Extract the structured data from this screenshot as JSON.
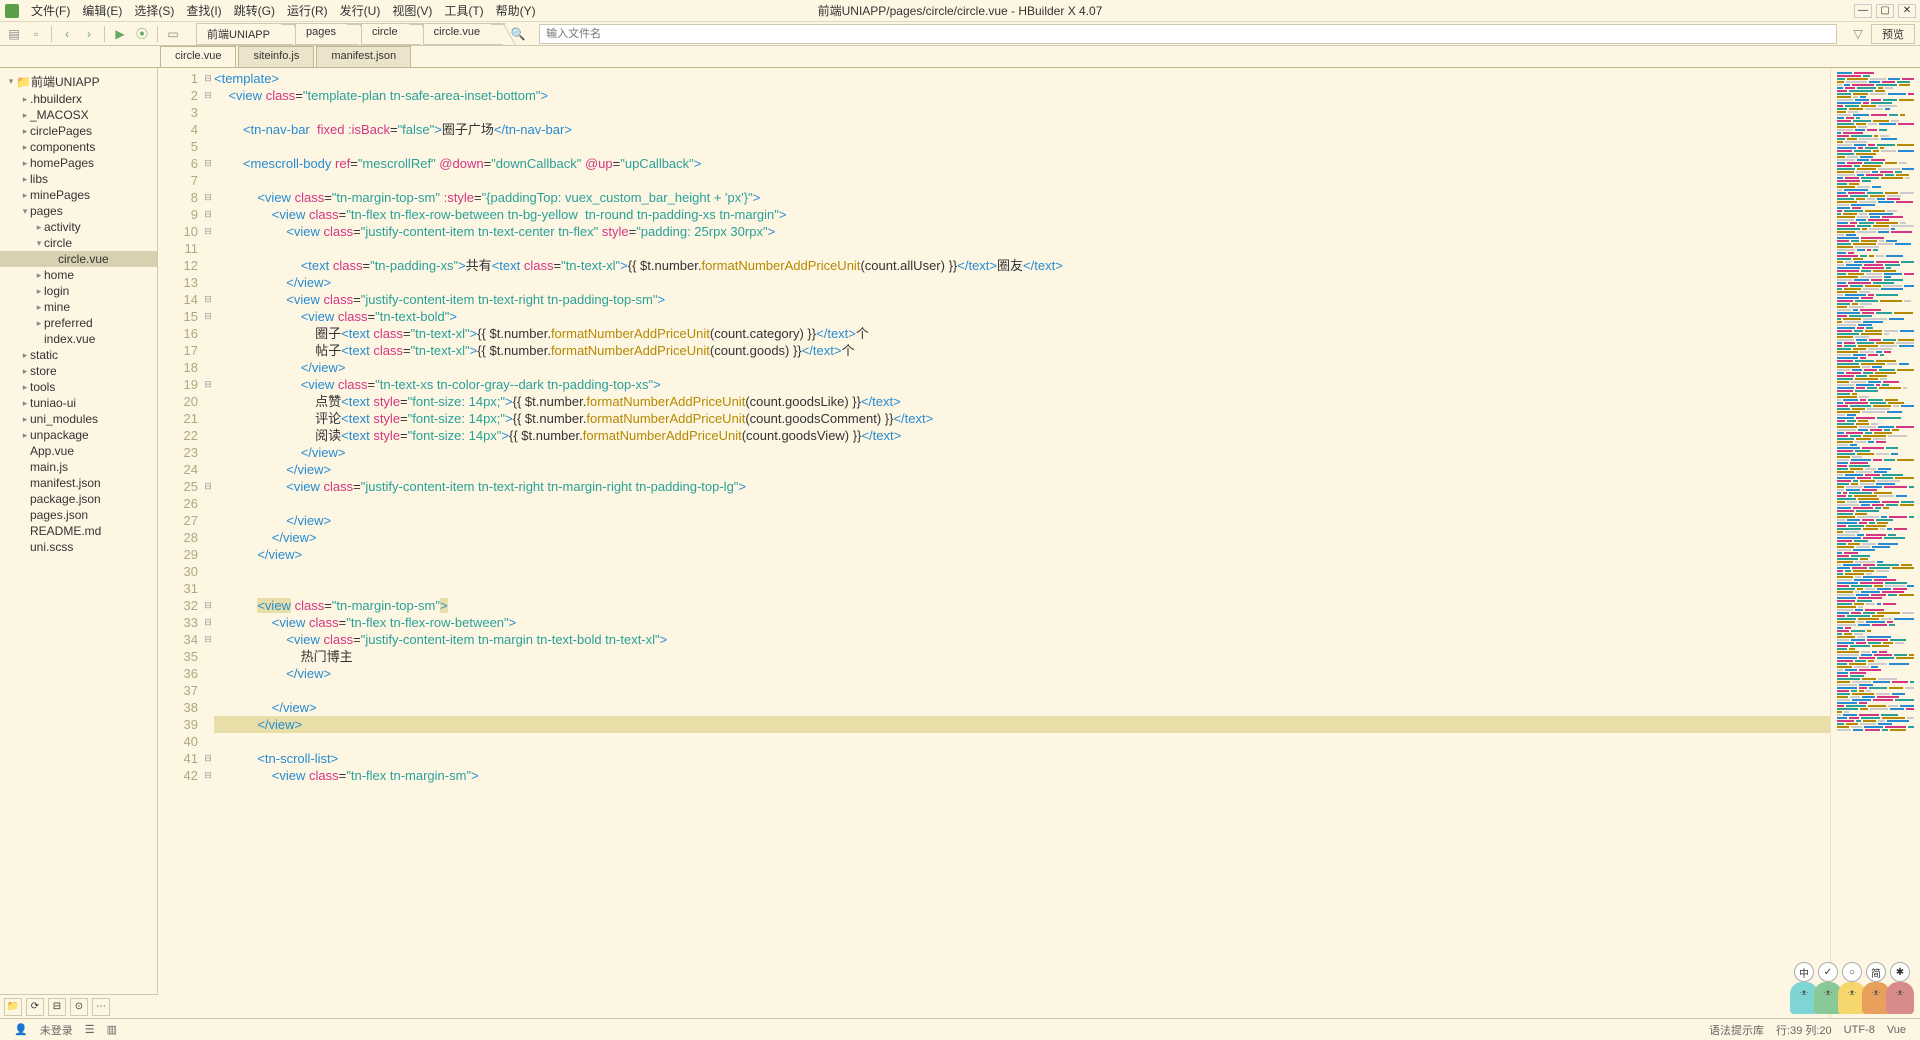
{
  "menu": {
    "items": [
      "文件(F)",
      "编辑(E)",
      "选择(S)",
      "查找(I)",
      "跳转(G)",
      "运行(R)",
      "发行(U)",
      "视图(V)",
      "工具(T)",
      "帮助(Y)"
    ],
    "title": "前端UNIAPP/pages/circle/circle.vue - HBuilder X 4.07"
  },
  "toolbar": {
    "crumbs": [
      "前端UNIAPP",
      "pages",
      "circle",
      "circle.vue"
    ],
    "search_ph": "输入文件名",
    "preview": "预览"
  },
  "tabs": [
    "circle.vue",
    "siteinfo.js",
    "manifest.json"
  ],
  "tree": [
    {
      "d": 0,
      "a": "▾",
      "t": "前端UNIAPP",
      "icon": "📁"
    },
    {
      "d": 1,
      "a": "▸",
      "t": ".hbuilderx"
    },
    {
      "d": 1,
      "a": "▸",
      "t": "_MACOSX"
    },
    {
      "d": 1,
      "a": "▸",
      "t": "circlePages"
    },
    {
      "d": 1,
      "a": "▸",
      "t": "components"
    },
    {
      "d": 1,
      "a": "▸",
      "t": "homePages"
    },
    {
      "d": 1,
      "a": "▸",
      "t": "libs"
    },
    {
      "d": 1,
      "a": "▸",
      "t": "minePages"
    },
    {
      "d": 1,
      "a": "▾",
      "t": "pages"
    },
    {
      "d": 2,
      "a": "▸",
      "t": "activity"
    },
    {
      "d": 2,
      "a": "▾",
      "t": "circle"
    },
    {
      "d": 3,
      "a": "",
      "t": "circle.vue",
      "sel": true
    },
    {
      "d": 2,
      "a": "▸",
      "t": "home"
    },
    {
      "d": 2,
      "a": "▸",
      "t": "login"
    },
    {
      "d": 2,
      "a": "▸",
      "t": "mine"
    },
    {
      "d": 2,
      "a": "▸",
      "t": "preferred"
    },
    {
      "d": 2,
      "a": "",
      "t": "index.vue"
    },
    {
      "d": 1,
      "a": "▸",
      "t": "static"
    },
    {
      "d": 1,
      "a": "▸",
      "t": "store"
    },
    {
      "d": 1,
      "a": "▸",
      "t": "tools"
    },
    {
      "d": 1,
      "a": "▸",
      "t": "tuniao-ui"
    },
    {
      "d": 1,
      "a": "▸",
      "t": "uni_modules"
    },
    {
      "d": 1,
      "a": "▸",
      "t": "unpackage"
    },
    {
      "d": 1,
      "a": "",
      "t": "App.vue"
    },
    {
      "d": 1,
      "a": "",
      "t": "main.js"
    },
    {
      "d": 1,
      "a": "",
      "t": "manifest.json"
    },
    {
      "d": 1,
      "a": "",
      "t": "package.json"
    },
    {
      "d": 1,
      "a": "",
      "t": "pages.json"
    },
    {
      "d": 1,
      "a": "",
      "t": "README.md"
    },
    {
      "d": 1,
      "a": "",
      "t": "uni.scss"
    }
  ],
  "status": {
    "login": "未登录",
    "lang": "语法提示库",
    "pos": "行:39 列:20",
    "enc": "UTF-8",
    "type": "Vue"
  },
  "cats": [
    {
      "c": "#7fd4d4",
      "b": "中"
    },
    {
      "c": "#89c997",
      "b": "✓"
    },
    {
      "c": "#f5d76e",
      "b": "○"
    },
    {
      "c": "#e8a05c",
      "b": "简"
    },
    {
      "c": "#d98b8b",
      "b": "✱"
    }
  ],
  "code": [
    {
      "n": 1,
      "f": "⊟",
      "h": "<span class='tag'>&lt;template&gt;</span>"
    },
    {
      "n": 2,
      "f": "⊟",
      "h": "    <span class='tag'>&lt;view</span> <span class='attr'>class</span>=<span class='str'>\"template-plan tn-safe-area-inset-bottom\"</span><span class='tag'>&gt;</span>"
    },
    {
      "n": 3,
      "f": "",
      "h": ""
    },
    {
      "n": 4,
      "f": "",
      "h": "        <span class='tag'>&lt;tn-nav-bar</span>  <span class='attr'>fixed :isBack</span>=<span class='str'>\"false\"</span><span class='tag'>&gt;</span>圈子广场<span class='tag'>&lt;/tn-nav-bar&gt;</span>"
    },
    {
      "n": 5,
      "f": "",
      "h": ""
    },
    {
      "n": 6,
      "f": "⊟",
      "h": "        <span class='tag'>&lt;mescroll-body</span> <span class='attr'>ref</span>=<span class='str'>\"mescrollRef\"</span> <span class='attr'>@down</span>=<span class='str'>\"downCallback\"</span> <span class='attr'>@up</span>=<span class='str'>\"upCallback\"</span><span class='tag'>&gt;</span>"
    },
    {
      "n": 7,
      "f": "",
      "h": ""
    },
    {
      "n": 8,
      "f": "⊟",
      "h": "            <span class='tag'>&lt;view</span> <span class='attr'>class</span>=<span class='str'>\"tn-margin-top-sm\"</span> <span class='attr'>:style</span>=<span class='str'>\"{paddingTop: vuex_custom_bar_height + 'px'}\"</span><span class='tag'>&gt;</span>"
    },
    {
      "n": 9,
      "f": "⊟",
      "h": "                <span class='tag'>&lt;view</span> <span class='attr'>class</span>=<span class='str'>\"tn-flex tn-flex-row-between tn-bg-yellow  tn-round tn-padding-xs tn-margin\"</span><span class='tag'>&gt;</span>"
    },
    {
      "n": 10,
      "f": "⊟",
      "h": "                    <span class='tag'>&lt;view</span> <span class='attr'>class</span>=<span class='str'>\"justify-content-item tn-text-center tn-flex\"</span> <span class='attr'>style</span>=<span class='str'>\"padding: 25rpx 30rpx\"</span><span class='tag'>&gt;</span>"
    },
    {
      "n": 11,
      "f": "",
      "h": ""
    },
    {
      "n": 12,
      "f": "",
      "h": "                        <span class='tag'>&lt;text</span> <span class='attr'>class</span>=<span class='str'>\"tn-padding-xs\"</span><span class='tag'>&gt;</span>共有<span class='tag'>&lt;text</span> <span class='attr'>class</span>=<span class='str'>\"tn-text-xl\"</span><span class='tag'>&gt;</span>{{ $t.number.<span class='fn'>formatNumberAddPriceUnit</span>(count.allUser) }}<span class='tag'>&lt;/text&gt;</span>圈友<span class='tag'>&lt;/text&gt;</span>"
    },
    {
      "n": 13,
      "f": "",
      "h": "                    <span class='tag'>&lt;/view&gt;</span>"
    },
    {
      "n": 14,
      "f": "⊟",
      "h": "                    <span class='tag'>&lt;view</span> <span class='attr'>class</span>=<span class='str'>\"justify-content-item tn-text-right tn-padding-top-sm\"</span><span class='tag'>&gt;</span>"
    },
    {
      "n": 15,
      "f": "⊟",
      "h": "                        <span class='tag'>&lt;view</span> <span class='attr'>class</span>=<span class='str'>\"tn-text-bold\"</span><span class='tag'>&gt;</span>"
    },
    {
      "n": 16,
      "f": "",
      "h": "                            圈子<span class='tag'>&lt;text</span> <span class='attr'>class</span>=<span class='str'>\"tn-text-xl\"</span><span class='tag'>&gt;</span>{{ $t.number.<span class='fn'>formatNumberAddPriceUnit</span>(count.category) }}<span class='tag'>&lt;/text&gt;</span>个"
    },
    {
      "n": 17,
      "f": "",
      "h": "                            帖子<span class='tag'>&lt;text</span> <span class='attr'>class</span>=<span class='str'>\"tn-text-xl\"</span><span class='tag'>&gt;</span>{{ $t.number.<span class='fn'>formatNumberAddPriceUnit</span>(count.goods) }}<span class='tag'>&lt;/text&gt;</span>个"
    },
    {
      "n": 18,
      "f": "",
      "h": "                        <span class='tag'>&lt;/view&gt;</span>"
    },
    {
      "n": 19,
      "f": "⊟",
      "h": "                        <span class='tag'>&lt;view</span> <span class='attr'>class</span>=<span class='str'>\"tn-text-xs tn-color-gray--dark tn-padding-top-xs\"</span><span class='tag'>&gt;</span>"
    },
    {
      "n": 20,
      "f": "",
      "h": "                            点赞<span class='tag'>&lt;text</span> <span class='attr'>style</span>=<span class='str'>\"font-size: 14px;\"</span><span class='tag'>&gt;</span>{{ $t.number.<span class='fn'>formatNumberAddPriceUnit</span>(count.goodsLike) }}<span class='tag'>&lt;/text&gt;</span>"
    },
    {
      "n": 21,
      "f": "",
      "h": "                            评论<span class='tag'>&lt;text</span> <span class='attr'>style</span>=<span class='str'>\"font-size: 14px;\"</span><span class='tag'>&gt;</span>{{ $t.number.<span class='fn'>formatNumberAddPriceUnit</span>(count.goodsComment) }}<span class='tag'>&lt;/text&gt;</span>"
    },
    {
      "n": 22,
      "f": "",
      "h": "                            阅读<span class='tag'>&lt;text</span> <span class='attr'>style</span>=<span class='str'>\"font-size: 14px\"</span><span class='tag'>&gt;</span>{{ $t.number.<span class='fn'>formatNumberAddPriceUnit</span>(count.goodsView) }}<span class='tag'>&lt;/text&gt;</span>"
    },
    {
      "n": 23,
      "f": "",
      "h": "                        <span class='tag'>&lt;/view&gt;</span>"
    },
    {
      "n": 24,
      "f": "",
      "h": "                    <span class='tag'>&lt;/view&gt;</span>"
    },
    {
      "n": 25,
      "f": "⊟",
      "h": "                    <span class='tag'>&lt;view</span> <span class='attr'>class</span>=<span class='str'>\"justify-content-item tn-text-right tn-margin-right tn-padding-top-lg\"</span><span class='tag'>&gt;</span>"
    },
    {
      "n": 26,
      "f": "",
      "h": ""
    },
    {
      "n": 27,
      "f": "",
      "h": "                    <span class='tag'>&lt;/view&gt;</span>"
    },
    {
      "n": 28,
      "f": "",
      "h": "                <span class='tag'>&lt;/view&gt;</span>"
    },
    {
      "n": 29,
      "f": "",
      "h": "            <span class='tag'>&lt;/view&gt;</span>"
    },
    {
      "n": 30,
      "f": "",
      "h": ""
    },
    {
      "n": 31,
      "f": "",
      "h": ""
    },
    {
      "n": 32,
      "f": "⊟",
      "h": "            <span class='tag' style='background:#e8dfa8'>&lt;view</span> <span class='attr'>class</span>=<span class='str'>\"tn-margin-top-sm\"</span><span class='tag' style='background:#e8dfa8'>&gt;</span>"
    },
    {
      "n": 33,
      "f": "⊟",
      "h": "                <span class='tag'>&lt;view</span> <span class='attr'>class</span>=<span class='str'>\"tn-flex tn-flex-row-between\"</span><span class='tag'>&gt;</span>"
    },
    {
      "n": 34,
      "f": "⊟",
      "h": "                    <span class='tag'>&lt;view</span> <span class='attr'>class</span>=<span class='str'>\"justify-content-item tn-margin tn-text-bold tn-text-xl\"</span><span class='tag'>&gt;</span>"
    },
    {
      "n": 35,
      "f": "",
      "h": "                        热门博主"
    },
    {
      "n": 36,
      "f": "",
      "h": "                    <span class='tag'>&lt;/view&gt;</span>"
    },
    {
      "n": 37,
      "f": "",
      "h": ""
    },
    {
      "n": 38,
      "f": "",
      "h": "                <span class='tag'>&lt;/view&gt;</span>"
    },
    {
      "n": 39,
      "f": "",
      "h": "            <span class='tag' style='background:#e8dfa8'>&lt;/view&gt;</span>",
      "hl": true
    },
    {
      "n": 40,
      "f": "",
      "h": ""
    },
    {
      "n": 41,
      "f": "⊟",
      "h": "            <span class='tag'>&lt;tn-scroll-list&gt;</span>"
    },
    {
      "n": 42,
      "f": "⊟",
      "h": "                <span class='tag'>&lt;view</span> <span class='attr'>class</span>=<span class='str'>\"tn-flex tn-margin-sm\"</span><span class='tag'>&gt;</span>"
    }
  ]
}
